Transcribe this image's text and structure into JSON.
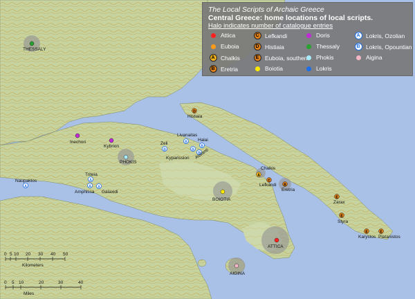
{
  "legend": {
    "title": "The Local Scripts of Archaic Greece",
    "subtitle": "Central Greece: home locations of local scripts.",
    "note": "Halo indicates number of catalogue entries",
    "items": [
      {
        "label": "Attica",
        "color": "#ff2020",
        "mark": ""
      },
      {
        "label": "Euboia",
        "color": "#ff9a1a",
        "mark": ""
      },
      {
        "label": "Chalkis",
        "color": "#f1b21c",
        "mark": "A"
      },
      {
        "label": "Eretria",
        "color": "#e0801a",
        "mark": "B"
      },
      {
        "label": "Lefkandi",
        "color": "#e0801a",
        "mark": "C"
      },
      {
        "label": "Histiaia",
        "color": "#e0801a",
        "mark": "D"
      },
      {
        "label": "Euboia, southern",
        "color": "#e0801a",
        "mark": "E"
      },
      {
        "label": "Boiotia",
        "color": "#ffea00",
        "mark": ""
      },
      {
        "label": "Doris",
        "color": "#c02bd6",
        "mark": ""
      },
      {
        "label": "Thessaly",
        "color": "#29a32f",
        "mark": ""
      },
      {
        "label": "Phokis",
        "color": "#a8ecff",
        "mark": ""
      },
      {
        "label": "Lokris",
        "color": "#1e6ee8",
        "mark": ""
      },
      {
        "label": "Lokris, Ozolian",
        "color": "#ffffff",
        "mark": "A"
      },
      {
        "label": "Lokris, Opountian",
        "color": "#ffffff",
        "mark": "B"
      },
      {
        "label": "Aigina",
        "color": "#f2b6c4",
        "mark": ""
      }
    ]
  },
  "places": {
    "thessaly": "THESSALY",
    "histiaia": "Histiaia",
    "inechori": "Inechori",
    "kybrion": "Kybrion",
    "phokis": "PHOKIS",
    "livanaitas": "Livanaitas",
    "zeli": "Zeli",
    "halai": "Halai",
    "kyparission": "Kyparission",
    "atalanti": "Atalanti",
    "naupaktos": "Naupaktos",
    "triteia": "Triteia",
    "amphissa": "Amphissa",
    "galaxidi": "Galaxidi",
    "chalkis": "Chalkis",
    "lefkandi": "Lefkandi",
    "eretria": "Eretria",
    "boiotia": "BOIOTIA",
    "zarax": "Zarax",
    "styra": "Styra",
    "karystos": "Karystos",
    "platanistos": "Platanistos",
    "attica": "ATTICA",
    "aigina": "AIGINA"
  },
  "scale": {
    "km_label": "Kilometers",
    "km_ticks": [
      "0",
      "5",
      "10",
      "20",
      "30",
      "40",
      "50"
    ],
    "mi_label": "Miles",
    "mi_ticks": [
      "0",
      "5",
      "10",
      "20",
      "30",
      "40"
    ]
  }
}
